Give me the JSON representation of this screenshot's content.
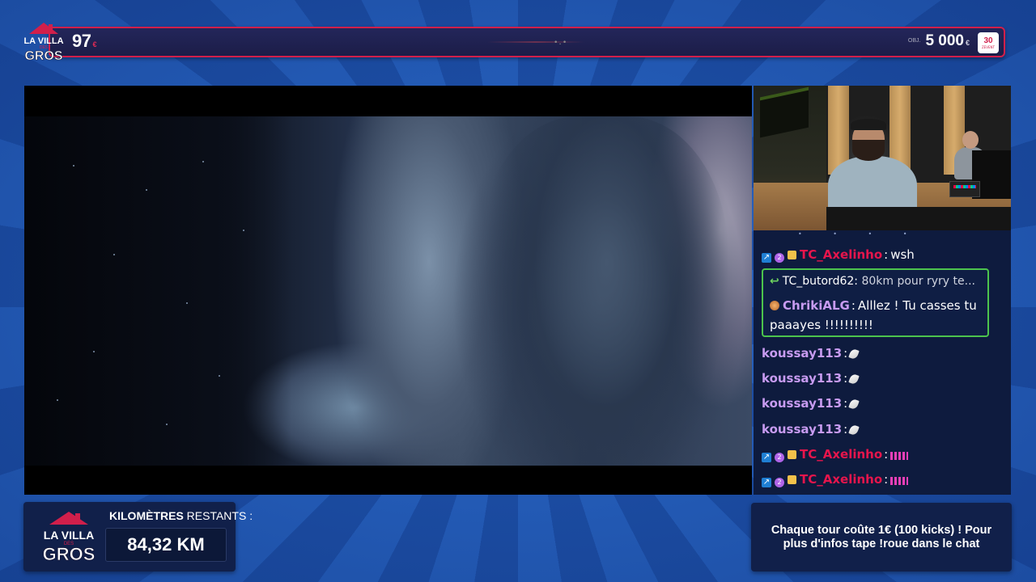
{
  "top_bar": {
    "count_value": "97",
    "count_unit": "€",
    "goal_prefix": "OBJ.",
    "goal_value": "5 000",
    "goal_unit": "€",
    "badge_number": "30",
    "badge_sub": "ZEVENT"
  },
  "logo": {
    "line1": "LA VILLA",
    "line2": "DES",
    "line3": "GROS"
  },
  "chat": {
    "messages": [
      {
        "user": "TC_Axelinho",
        "sep": ":",
        "text": "wsh",
        "badges": [
          "arrow-badge",
          "number-badge",
          "gift-badge"
        ],
        "badge_num": "2"
      },
      {
        "reply_user": "TC_butord62:",
        "reply_text": "80km pour ryry te...",
        "user": "ChrikiALG",
        "sep": ":",
        "text": "Alllez ! Tu casses tu paaayes !!!!!!!!!!"
      },
      {
        "user": "koussay113",
        "sep": ":",
        "emote": "feather-emote"
      },
      {
        "user": "koussay113",
        "sep": ":",
        "emote": "feather-emote"
      },
      {
        "user": "koussay113",
        "sep": ":",
        "emote": "feather-emote"
      },
      {
        "user": "koussay113",
        "sep": ":",
        "emote": "feather-emote"
      },
      {
        "user": "TC_Axelinho",
        "sep": ":",
        "emote": "pink-bars-emote",
        "badges": [
          "arrow-badge",
          "number-badge",
          "gift-badge"
        ],
        "badge_num": "2"
      },
      {
        "user": "TC_Axelinho",
        "sep": ":",
        "emote": "pink-bars-emote",
        "badges": [
          "arrow-badge",
          "number-badge",
          "gift-badge"
        ],
        "badge_num": "2"
      }
    ]
  },
  "km_panel": {
    "label_bold": "KILOMÈTRES",
    "label_rest": " RESTANTS :",
    "value": "84,32 KM"
  },
  "info_panel": {
    "text": "Chaque tour coûte 1€ (100 kicks) ! Pour plus d'infos tape !roue dans le chat"
  },
  "colors": {
    "background": "#2158b0",
    "accent_red": "#d11f4b",
    "panel": "#11204a",
    "chat_bg": "#0e1b3e",
    "highlight_green": "#4cc34d",
    "username_red": "#e6154c",
    "username_purple": "#c79bf0"
  }
}
